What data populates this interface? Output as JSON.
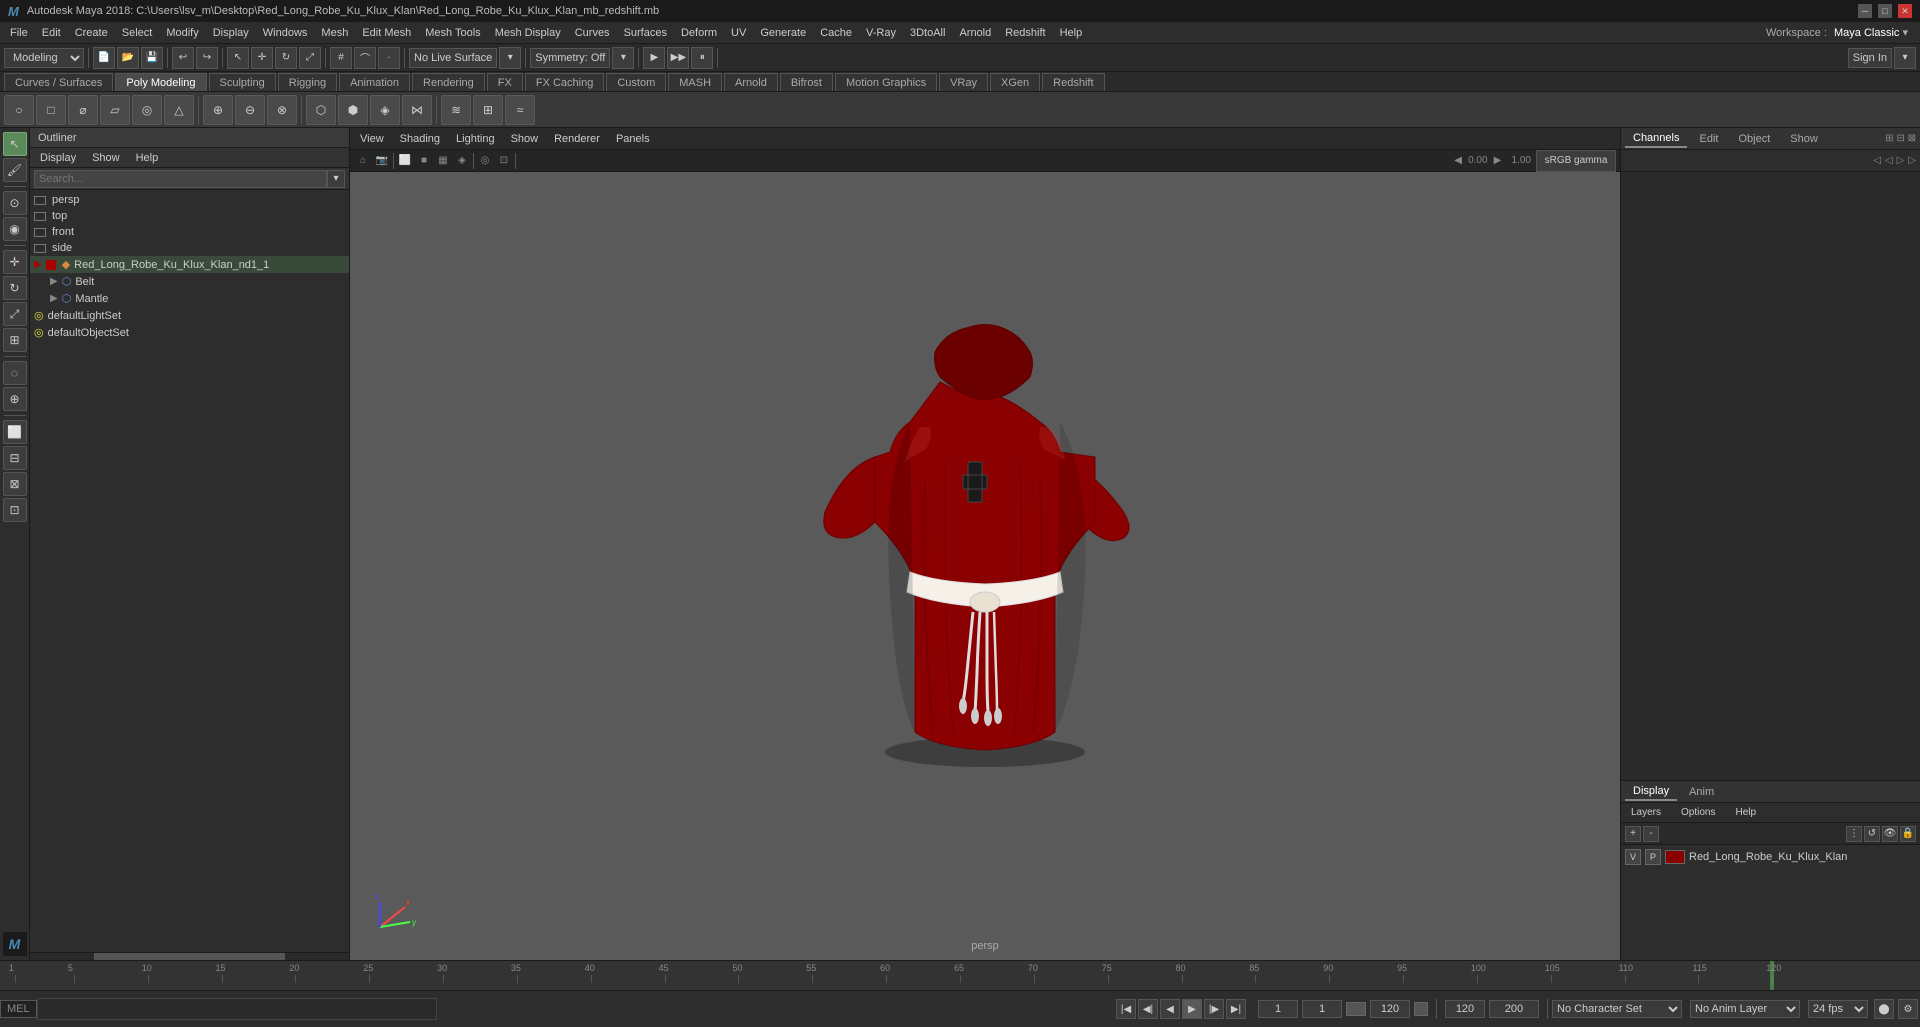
{
  "titlebar": {
    "title": "Autodesk Maya 2018: C:\\Users\\lsv_m\\Desktop\\Red_Long_Robe_Ku_Klux_Klan\\Red_Long_Robe_Ku_Klux_Klan_mb_redshift.mb",
    "min": "─",
    "restore": "□",
    "close": "✕"
  },
  "menubar": {
    "items": [
      "File",
      "Edit",
      "Create",
      "Select",
      "Modify",
      "Display",
      "Windows",
      "Mesh",
      "Edit Mesh",
      "Mesh Tools",
      "Mesh Display",
      "Curves",
      "Surfaces",
      "Deform",
      "UV",
      "Generate",
      "Cache",
      "V-Ray",
      "3DtoAll",
      "Arnold",
      "Redshift",
      "Help"
    ]
  },
  "workspace": {
    "label": "Workspace :",
    "value": "Maya Classic"
  },
  "toolbar1": {
    "mode_select": "Modeling",
    "no_live_surface": "No Live Surface",
    "symmetry": "Symmetry: Off",
    "sign_in": "Sign In"
  },
  "shelf_tabs": {
    "items": [
      "Curves / Surfaces",
      "Poly Modeling",
      "Sculpting",
      "Rigging",
      "Animation",
      "Rendering",
      "FX",
      "FX Caching",
      "Custom",
      "MASH",
      "Arnold",
      "Bifrost",
      "Motion Graphics",
      "VRay",
      "XGen",
      "Redshift"
    ]
  },
  "outliner": {
    "title": "Outliner",
    "menu_items": [
      "Display",
      "Show",
      "Help"
    ],
    "search_placeholder": "Search...",
    "items": [
      {
        "name": "persp",
        "type": "camera",
        "indent": 0
      },
      {
        "name": "top",
        "type": "camera",
        "indent": 0
      },
      {
        "name": "front",
        "type": "camera",
        "indent": 0
      },
      {
        "name": "side",
        "type": "camera",
        "indent": 0
      },
      {
        "name": "Red_Long_Robe_Ku_Klux_Klan_nd1_1",
        "type": "group",
        "indent": 0
      },
      {
        "name": "Belt",
        "type": "mesh",
        "indent": 1
      },
      {
        "name": "Mantle",
        "type": "mesh",
        "indent": 1
      },
      {
        "name": "defaultLightSet",
        "type": "set",
        "indent": 0
      },
      {
        "name": "defaultObjectSet",
        "type": "set",
        "indent": 0
      }
    ]
  },
  "viewport": {
    "menu": [
      "View",
      "Shading",
      "Lighting",
      "Show",
      "Renderer",
      "Panels"
    ],
    "label": "persp",
    "gamma_value": "0.00",
    "gamma_value2": "1.00",
    "color_space": "sRGB gamma"
  },
  "channel_box": {
    "tabs": [
      "Channels",
      "Edit",
      "Object",
      "Show"
    ]
  },
  "display_panel": {
    "tabs": [
      "Display",
      "Anim"
    ],
    "menu_items": [
      "Layers",
      "Options",
      "Help"
    ],
    "layer_name": "Red_Long_Robe_Ku_Klux_Klan",
    "layer_v": "V",
    "layer_p": "P"
  },
  "timeline": {
    "numbers": [
      "1",
      "5",
      "10",
      "15",
      "20",
      "25",
      "30",
      "35",
      "40",
      "45",
      "50",
      "55",
      "60",
      "65",
      "70",
      "75",
      "80",
      "85",
      "90",
      "95",
      "100",
      "105",
      "110",
      "115",
      "120",
      "1"
    ],
    "current_frame": "120"
  },
  "bottom_bar": {
    "frame_start": "1",
    "frame_current": "1",
    "range_start": "1",
    "range_end": "120",
    "anim_end": "120",
    "total_end": "200",
    "no_character": "No Character Set",
    "no_anim_layer": "No Anim Layer",
    "fps": "24 fps",
    "mel_label": "MEL"
  }
}
